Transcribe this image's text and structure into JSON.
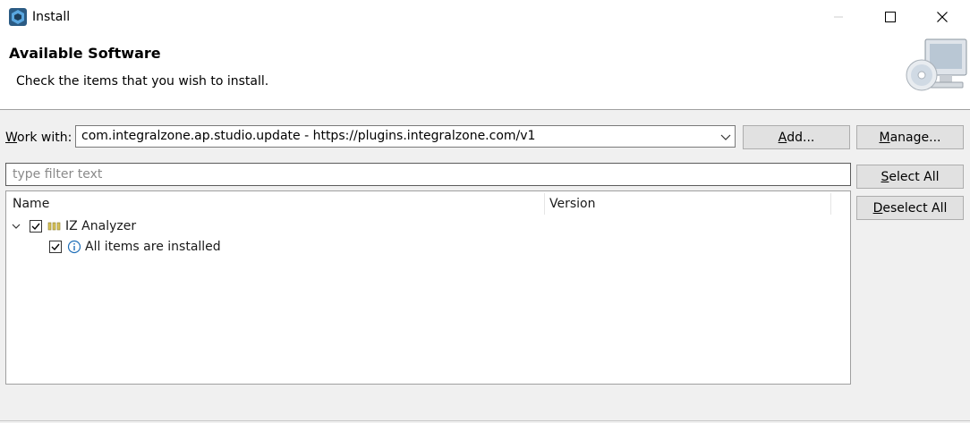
{
  "window": {
    "title": "Install",
    "icon": "eclipse-app-icon",
    "minimize_icon": "minimize-icon",
    "maximize_icon": "maximize-icon",
    "close_icon": "close-icon"
  },
  "header": {
    "title": "Available Software",
    "description": "Check the items that you wish to install.",
    "image": "monitor-cd-icon"
  },
  "work_with": {
    "label_underlined": "W",
    "label_rest": "ork with:",
    "value": "com.integralzone.ap.studio.update - https://plugins.integralzone.com/v1",
    "dropdown_icon": "chevron-down-icon"
  },
  "buttons": {
    "add": {
      "u": "A",
      "rest": "dd..."
    },
    "manage": {
      "u": "M",
      "rest": "anage..."
    },
    "select_all": {
      "u": "S",
      "rest": "elect All"
    },
    "deselect_all": {
      "u": "D",
      "rest": "eselect All"
    }
  },
  "filter": {
    "placeholder": "type filter text",
    "value": ""
  },
  "tree": {
    "columns": [
      "Name",
      "Version"
    ],
    "rows": [
      {
        "label": "IZ Analyzer",
        "checked": true,
        "expanded": true,
        "icon": "feature-group-icon",
        "version": ""
      },
      {
        "label": "All items are installed",
        "checked": true,
        "icon": "info-icon",
        "version": ""
      }
    ]
  },
  "colors": {
    "accent": "#1f6fb8",
    "border": "#a0a0a0",
    "button_bg": "#e1e1e1"
  }
}
